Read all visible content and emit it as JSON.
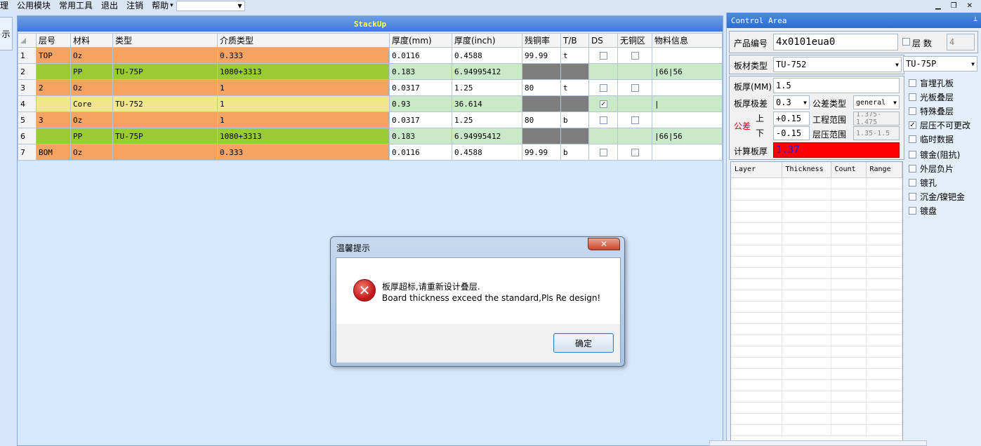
{
  "menu": {
    "partial_first": "理",
    "items": [
      "公用模块",
      "常用工具",
      "退出",
      "注销",
      "帮助"
    ],
    "help_arrow": "▾",
    "combo_value": ""
  },
  "window_controls": {
    "min": "▁",
    "restore": "❐",
    "close": "✕"
  },
  "left_strip": {
    "label": "示"
  },
  "grid": {
    "title": "StackUp",
    "headers": [
      "",
      "层号",
      "材料",
      "类型",
      "介质类型",
      "厚度(mm)",
      "厚度(inch)",
      "残铜率",
      "T/B",
      "DS",
      "无铜区",
      "物料信息"
    ],
    "rows": [
      {
        "no": "1",
        "layer": "TOP",
        "material": "Oz",
        "type": "",
        "dielectric": "0.333",
        "mm": "0.0116",
        "inch": "0.4588",
        "copper": "99.99",
        "tb": "t",
        "ds": false,
        "nocopper": false,
        "info": ""
      },
      {
        "no": "2",
        "layer": "",
        "material": "PP",
        "type": "TU-75P",
        "dielectric": "1080+3313",
        "mm": "0.183",
        "inch": "6.94995412",
        "copper": "",
        "tb": "",
        "ds": null,
        "nocopper": null,
        "info": "|66|56"
      },
      {
        "no": "3",
        "layer": "2",
        "material": "Oz",
        "type": "",
        "dielectric": "1",
        "mm": "0.0317",
        "inch": "1.25",
        "copper": "80",
        "tb": "t",
        "ds": false,
        "nocopper": false,
        "info": ""
      },
      {
        "no": "4",
        "layer": "",
        "material": "Core",
        "type": "TU-752",
        "dielectric": "1",
        "mm": "0.93",
        "inch": "36.614",
        "copper": "",
        "tb": "",
        "ds": true,
        "nocopper": null,
        "info": "|"
      },
      {
        "no": "5",
        "layer": "3",
        "material": "Oz",
        "type": "",
        "dielectric": "1",
        "mm": "0.0317",
        "inch": "1.25",
        "copper": "80",
        "tb": "b",
        "ds": false,
        "nocopper": false,
        "info": ""
      },
      {
        "no": "6",
        "layer": "",
        "material": "PP",
        "type": "TU-75P",
        "dielectric": "1080+3313",
        "mm": "0.183",
        "inch": "6.94995412",
        "copper": "",
        "tb": "",
        "ds": null,
        "nocopper": null,
        "info": "|66|56"
      },
      {
        "no": "7",
        "layer": "BOM",
        "material": "Oz",
        "type": "",
        "dielectric": "0.333",
        "mm": "0.0116",
        "inch": "0.4588",
        "copper": "99.99",
        "tb": "b",
        "ds": false,
        "nocopper": false,
        "info": ""
      }
    ]
  },
  "panel": {
    "title": "Control Area",
    "pin": "ᵠ",
    "product_label": "产品编号",
    "product_value": "4x0101eua0",
    "layers_label": "层  数",
    "layers_value": "4",
    "board_type_label": "板材类型",
    "board_type_value": "TU-752",
    "pp_type_value": "TU-75P",
    "thickness_label": "板厚(MM)",
    "thickness_value": "1.5",
    "tol_level_label": "板厚极差",
    "tol_level_value": "0.3",
    "tol_type_label": "公差类型",
    "tol_type_value": "general",
    "tol_label": "公差",
    "upper_label": "上",
    "lower_label": "下",
    "upper_value": "+0.15",
    "lower_value": "-0.15",
    "eng_range_label": "工程范围",
    "eng_range_value": "1.375-1.475",
    "press_range_label": "层压范围",
    "press_range_value": "1.35-1.5",
    "calc_label": "计算板厚",
    "calc_value": "1.37",
    "layer_table_headers": [
      "Layer",
      "Thickness",
      "Count",
      "Range"
    ],
    "options": [
      {
        "label": "盲埋孔板",
        "checked": false
      },
      {
        "label": "光板叠层",
        "checked": false
      },
      {
        "label": "特殊叠层",
        "checked": false
      },
      {
        "label": "层压不可更改",
        "checked": true
      },
      {
        "label": "临时数据",
        "checked": false
      },
      {
        "label": "镀金(阻抗)",
        "checked": false
      },
      {
        "label": "外层负片",
        "checked": false
      },
      {
        "label": "镀孔",
        "checked": false
      },
      {
        "label": "沉金/镍钯金",
        "checked": false
      },
      {
        "label": "镀盘",
        "checked": false
      }
    ],
    "colors": {
      "calc_bg": "#ff0000",
      "calc_fg": "#1a1aff",
      "tol_label": "#e00000"
    }
  },
  "dialog": {
    "title": "温馨提示",
    "close": "✕",
    "message_cn": "板厚超标,请重新设计叠层.",
    "message_en": "Board thickness exceed the standard,Pls Re design!",
    "ok_label": "确定",
    "icon": "error-icon"
  }
}
